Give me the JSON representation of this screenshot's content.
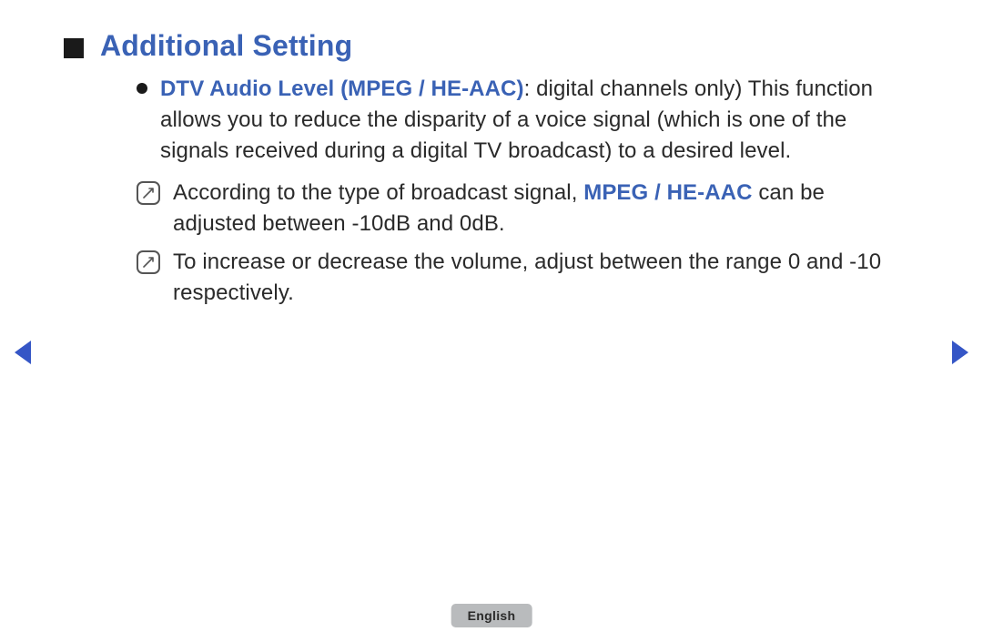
{
  "heading": "Additional Setting",
  "item": {
    "title": "DTV Audio Level (MPEG / HE-AAC)",
    "desc_before": ": digital channels only) This function allows you to reduce the disparity of a voice signal (which is one of the signals received during a digital TV broadcast) to a desired level."
  },
  "notes": {
    "n1_a": "According to the type of broadcast signal, ",
    "n1_bold": "MPEG / HE-AAC",
    "n1_b": " can be adjusted between -10dB and 0dB.",
    "n2": "To increase or decrease the volume, adjust between the range 0 and -10 respectively."
  },
  "footer": {
    "language": "English"
  }
}
